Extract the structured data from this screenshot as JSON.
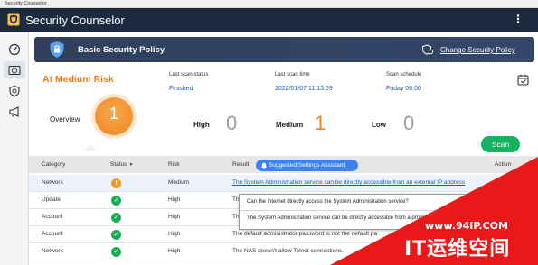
{
  "window": {
    "os_title": "Security Counselor",
    "controls": [
      "minimize-icon",
      "maximize-icon",
      "close-icon"
    ]
  },
  "app": {
    "title": "Security Counselor",
    "menu_icon": "kebab-menu-icon"
  },
  "sidebar": {
    "items": [
      {
        "icon": "dashboard-gauge-icon",
        "active": false
      },
      {
        "icon": "security-policy-icon",
        "active": true
      },
      {
        "icon": "shield-scan-icon",
        "active": false
      },
      {
        "icon": "megaphone-icon",
        "active": false
      }
    ]
  },
  "banner": {
    "title": "Basic Security Policy",
    "link": "Change Security Policy"
  },
  "status": {
    "risk": "At Medium Risk",
    "last_scan_status_label": "Last scan status",
    "last_scan_status_value": "Finished",
    "last_scan_time_label": "Last scan time",
    "last_scan_time_value": "2022/01/07 11:13:09",
    "scan_schedule_label": "Scan schedule",
    "scan_schedule_value": "Friday 06:00"
  },
  "overview": {
    "label": "Overview",
    "count": "1",
    "high_label": "High",
    "high_count": "0",
    "medium_label": "Medium",
    "medium_count": "1",
    "low_label": "Low",
    "low_count": "0",
    "colors": {
      "orange": "#ee8422",
      "green": "#14b361",
      "grey": "#9e9e9e"
    }
  },
  "scan_button": "Scan",
  "table": {
    "headers": {
      "category": "Category",
      "status": "Status",
      "risk": "Risk",
      "result": "Result",
      "action": "Action"
    },
    "assistant_button": "Suggested Settings Assistant",
    "rows": [
      {
        "category": "Network",
        "status": "warning",
        "risk": "Medium",
        "result": "The System Administration service can be directly accessible from an external IP address"
      },
      {
        "category": "Update",
        "status": "ok",
        "risk": "High",
        "result": "Th"
      },
      {
        "category": "Account",
        "status": "ok",
        "risk": "High",
        "result": "Th"
      },
      {
        "category": "Account",
        "status": "ok",
        "risk": "High",
        "result": "The default administrator password is not the default pa"
      },
      {
        "category": "Network",
        "status": "ok",
        "risk": "High",
        "result": "The NAS doesn't allow Telnet connections."
      }
    ]
  },
  "tooltip": {
    "question": "Can the internet directly access the System Administration service?",
    "answer": "The System Administration service can be directly accessible from a protocols: HTTP"
  },
  "watermark": {
    "url": "www.94IP.COM",
    "name": "IT运维空间"
  }
}
